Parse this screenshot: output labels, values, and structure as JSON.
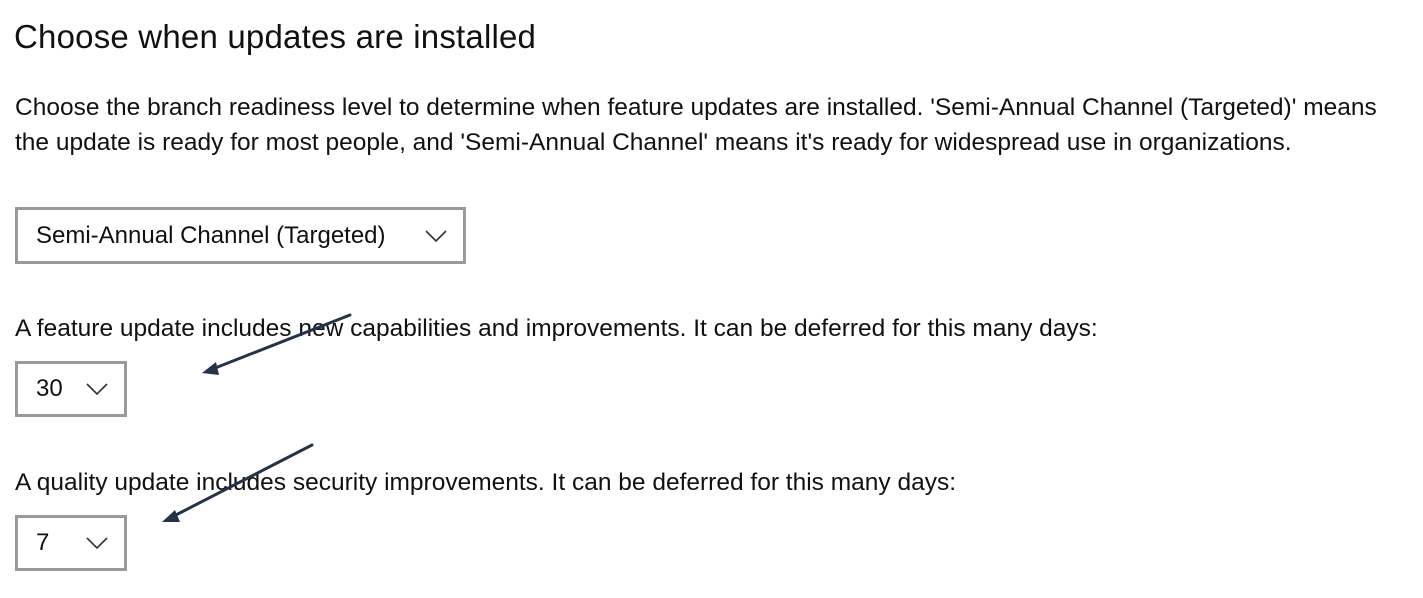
{
  "heading": "Choose when updates are installed",
  "description": "Choose the branch readiness level to determine when feature updates are installed. 'Semi-Annual Channel (Targeted)' means the update is ready for most people, and 'Semi-Annual Channel' means it's ready for widespread use in organizations.",
  "branch_readiness": {
    "selected": "Semi-Annual Channel (Targeted)",
    "icon": "chevron-down-icon"
  },
  "feature_update": {
    "label": "A feature update includes new capabilities and improvements. It can be deferred for this many days:",
    "selected": "30",
    "icon": "chevron-down-icon"
  },
  "quality_update": {
    "label": "A quality update includes security improvements. It can be deferred for this many days:",
    "selected": "7",
    "icon": "chevron-down-icon"
  },
  "colors": {
    "dropdown_border": "#9a9a9a",
    "annotation_arrow": "#253349",
    "text": "#111111"
  }
}
